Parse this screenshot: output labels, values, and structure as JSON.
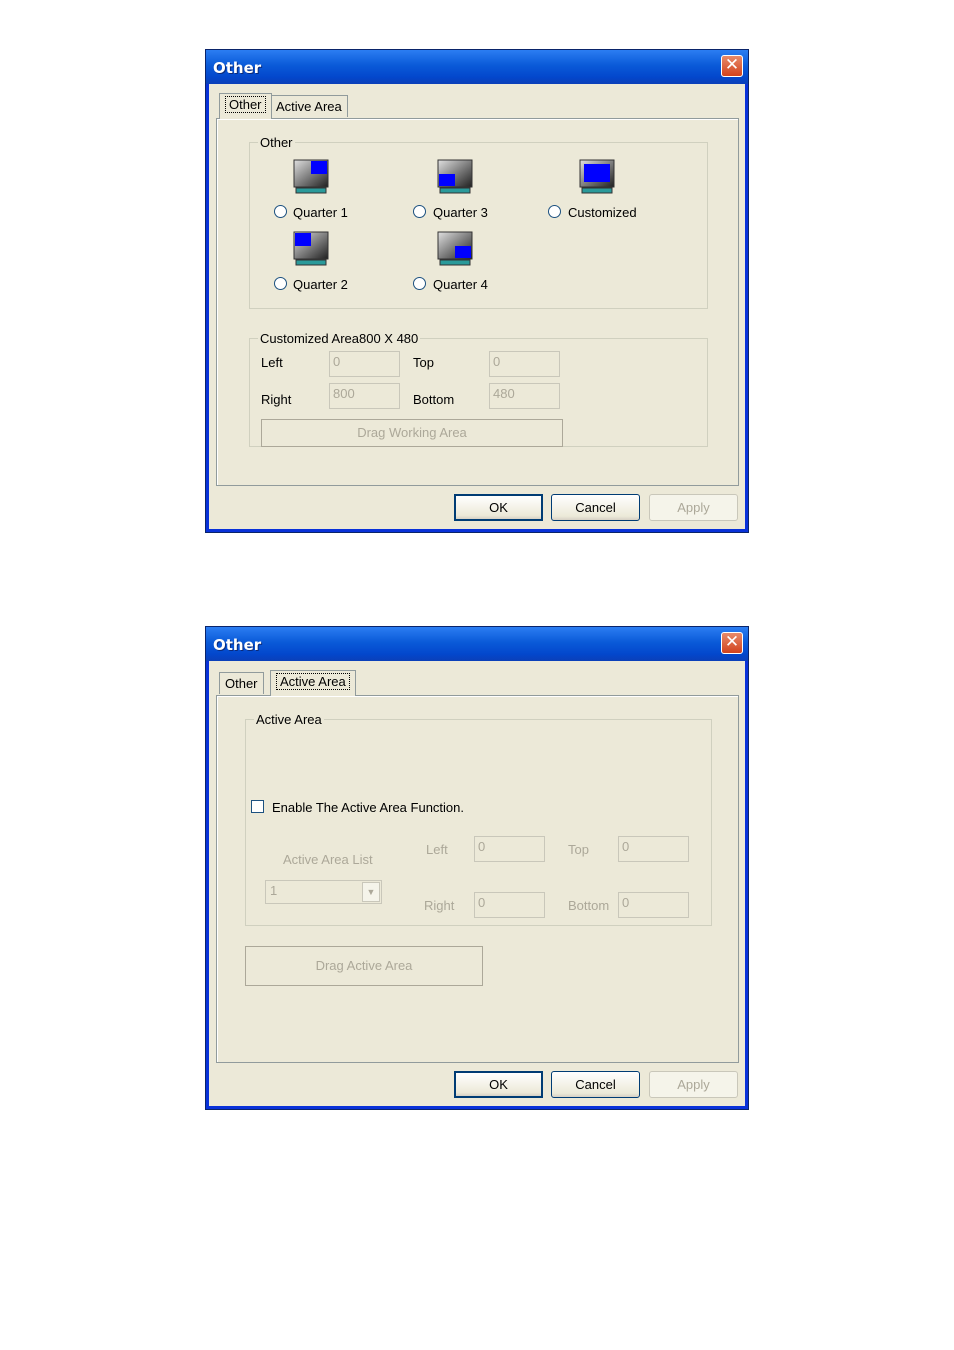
{
  "dialog1": {
    "title": "Other",
    "tabs": [
      "Other",
      "Active Area"
    ],
    "group_other": {
      "legend": "Other",
      "options": [
        "Quarter 1",
        "Quarter 3",
        "Customized",
        "Quarter 2",
        "Quarter 4"
      ]
    },
    "group_custom": {
      "legend": "Customized Area800 X 480",
      "left_label": "Left",
      "left_value": "0",
      "top_label": "Top",
      "top_value": "0",
      "right_label": "Right",
      "right_value": "800",
      "bottom_label": "Bottom",
      "bottom_value": "480",
      "drag_button": "Drag Working Area"
    },
    "buttons": {
      "ok": "OK",
      "cancel": "Cancel",
      "apply": "Apply"
    }
  },
  "dialog2": {
    "title": "Other",
    "tabs": [
      "Other",
      "Active Area"
    ],
    "group_active": {
      "legend": "Active Area",
      "enable_label": "Enable The Active Area Function.",
      "list_label": "Active Area List",
      "list_value": "1",
      "left_label": "Left",
      "left_value": "0",
      "top_label": "Top",
      "top_value": "0",
      "right_label": "Right",
      "right_value": "0",
      "bottom_label": "Bottom",
      "bottom_value": "0"
    },
    "drag_button": "Drag Active Area",
    "buttons": {
      "ok": "OK",
      "cancel": "Cancel",
      "apply": "Apply"
    }
  },
  "icons": {
    "close": "close-icon",
    "monitor": "monitor-icon"
  },
  "colors": {
    "titlebar": "#0a5ad8",
    "face": "#ece9d8",
    "close": "#d2421c",
    "screen_blue": "#0000ff"
  }
}
